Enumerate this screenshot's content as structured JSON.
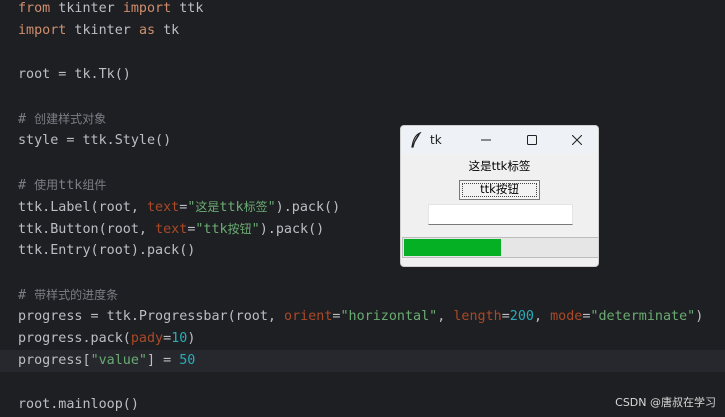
{
  "editor": {
    "lines": [
      {
        "segments": [
          {
            "t": "from",
            "c": "kw"
          },
          {
            "t": " tkinter ",
            "c": ""
          },
          {
            "t": "import",
            "c": "kw"
          },
          {
            "t": " ttk",
            "c": ""
          }
        ]
      },
      {
        "segments": [
          {
            "t": "import",
            "c": "kw"
          },
          {
            "t": " tkinter ",
            "c": ""
          },
          {
            "t": "as",
            "c": "kw"
          },
          {
            "t": " tk",
            "c": ""
          }
        ]
      },
      {
        "segments": []
      },
      {
        "segments": [
          {
            "t": "root = tk.Tk()",
            "c": ""
          }
        ]
      },
      {
        "segments": []
      },
      {
        "segments": [
          {
            "t": "# ",
            "c": "cm"
          },
          {
            "t": "创建样式对象",
            "c": "cmcn"
          }
        ]
      },
      {
        "segments": [
          {
            "t": "style = ttk.Style()",
            "c": ""
          }
        ]
      },
      {
        "segments": []
      },
      {
        "segments": [
          {
            "t": "# ",
            "c": "cm"
          },
          {
            "t": "使用",
            "c": "cmcn"
          },
          {
            "t": "ttk",
            "c": "cm"
          },
          {
            "t": "组件",
            "c": "cmcn"
          }
        ]
      },
      {
        "segments": [
          {
            "t": "ttk.Label(root, ",
            "c": ""
          },
          {
            "t": "text",
            "c": "prm"
          },
          {
            "t": "=",
            "c": ""
          },
          {
            "t": "\"",
            "c": "str"
          },
          {
            "t": "这是",
            "c": "strcn"
          },
          {
            "t": "ttk",
            "c": "str"
          },
          {
            "t": "标签",
            "c": "strcn"
          },
          {
            "t": "\"",
            "c": "str"
          },
          {
            "t": ").pack()",
            "c": ""
          }
        ]
      },
      {
        "segments": [
          {
            "t": "ttk.Button(root, ",
            "c": ""
          },
          {
            "t": "text",
            "c": "prm"
          },
          {
            "t": "=",
            "c": ""
          },
          {
            "t": "\"ttk",
            "c": "str"
          },
          {
            "t": "按钮",
            "c": "strcn"
          },
          {
            "t": "\"",
            "c": "str"
          },
          {
            "t": ").pack()",
            "c": ""
          }
        ]
      },
      {
        "segments": [
          {
            "t": "ttk.Entry(root).pack()",
            "c": ""
          }
        ]
      },
      {
        "segments": []
      },
      {
        "segments": [
          {
            "t": "# ",
            "c": "cm"
          },
          {
            "t": "带样式的进度条",
            "c": "cmcn"
          }
        ]
      },
      {
        "segments": [
          {
            "t": "progress = ttk.Progressbar(root, ",
            "c": ""
          },
          {
            "t": "orient",
            "c": "prm"
          },
          {
            "t": "=",
            "c": ""
          },
          {
            "t": "\"horizontal\"",
            "c": "str"
          },
          {
            "t": ", ",
            "c": ""
          },
          {
            "t": "length",
            "c": "prm"
          },
          {
            "t": "=",
            "c": ""
          },
          {
            "t": "200",
            "c": "num"
          },
          {
            "t": ", ",
            "c": ""
          },
          {
            "t": "mode",
            "c": "prm"
          },
          {
            "t": "=",
            "c": ""
          },
          {
            "t": "\"determinate\"",
            "c": "str"
          },
          {
            "t": ")",
            "c": ""
          }
        ]
      },
      {
        "segments": [
          {
            "t": "progress.pack(",
            "c": ""
          },
          {
            "t": "pady",
            "c": "prm"
          },
          {
            "t": "=",
            "c": ""
          },
          {
            "t": "10",
            "c": "num"
          },
          {
            "t": ")",
            "c": ""
          }
        ]
      },
      {
        "segments": [
          {
            "t": "progress[",
            "c": ""
          },
          {
            "t": "\"value\"",
            "c": "str"
          },
          {
            "t": "] = ",
            "c": ""
          },
          {
            "t": "50",
            "c": "num"
          }
        ]
      },
      {
        "segments": []
      },
      {
        "segments": [
          {
            "t": "root.mainloop()",
            "c": ""
          }
        ]
      }
    ],
    "highlighted_line": 16
  },
  "tk_window": {
    "title": "tk",
    "icon": "feather-icon",
    "label_text": "这是ttk标签",
    "button_text": "ttk按钮",
    "entry_value": "",
    "progress_value": 50,
    "progress_max": 100,
    "progress_color": "#06b025"
  },
  "watermark": "CSDN @唐叔在学习",
  "colors": {
    "editor_bg": "#1e1f22",
    "keyword": "#cf8e6d",
    "string": "#6aab73",
    "number": "#2aacb8",
    "param": "#aa4926",
    "comment": "#7a7e85"
  }
}
